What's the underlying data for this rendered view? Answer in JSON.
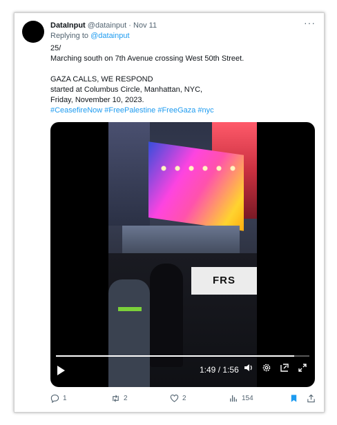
{
  "tweet": {
    "display_name": "DataInput",
    "handle": "@datainput",
    "separator": "·",
    "date": "Nov 11",
    "reply_prefix": "Replying to",
    "reply_handle": "@datainput",
    "lines": {
      "l1": "25/",
      "l2": "Marching south on 7th Avenue crossing West 50th Street.",
      "l3": "GAZA CALLS, WE RESPOND",
      "l4": "started at Columbus Circle, Manhattan, NYC,",
      "l5": "Friday, November 10, 2023."
    },
    "hashtags": [
      "#CeasefireNow",
      "#FreePalestine",
      "#FreeGaza",
      "#nyc"
    ]
  },
  "video": {
    "elapsed": "1:49",
    "duration": "1:56",
    "time_separator": "/",
    "progress": 0.94,
    "banner_text": "FRS"
  },
  "actions": {
    "replies": "1",
    "reposts": "2",
    "likes": "2",
    "views": "154"
  },
  "colors": {
    "link": "#1d9bf0",
    "muted": "#536471",
    "bookmark": "#1d9bf0"
  },
  "icons": [
    "more-icon",
    "play-icon",
    "volume-icon",
    "settings-icon",
    "pip-icon",
    "fullscreen-icon",
    "reply-icon",
    "repost-icon",
    "like-icon",
    "views-icon",
    "bookmark-icon",
    "share-icon"
  ]
}
